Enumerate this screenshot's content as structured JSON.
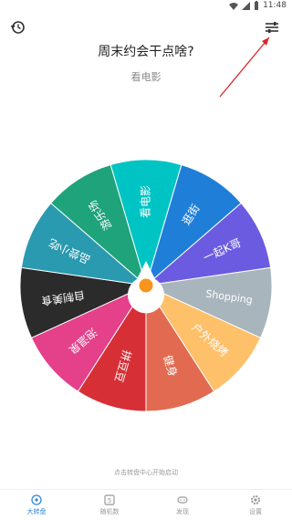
{
  "status_bar": {
    "time": "11:48"
  },
  "header": {
    "question": "周末约会干点啥?",
    "answer": "看电影"
  },
  "wheel": {
    "segments": [
      {
        "label": "看电影",
        "color": "#00c4c4"
      },
      {
        "label": "逛街",
        "color": "#1f7fd8"
      },
      {
        "label": "一起K哥",
        "color": "#6b5be0"
      },
      {
        "label": "Shopping",
        "color": "#a9b5bd"
      },
      {
        "label": "户外烧烤",
        "color": "#ffc06a"
      },
      {
        "label": "健身",
        "color": "#e26a50"
      },
      {
        "label": "拼豆豆",
        "color": "#d72f36"
      },
      {
        "label": "泡温泉",
        "color": "#e5408a"
      },
      {
        "label": "自制美食",
        "color": "#2b2b2b"
      },
      {
        "label": "品尝小吃",
        "color": "#2a9ab0"
      },
      {
        "label": "游乐场",
        "color": "#1ea37a"
      }
    ]
  },
  "hint": "点击转盘中心开始启动",
  "nav": [
    {
      "label": "大转盘",
      "icon": "wheel-icon",
      "active": true
    },
    {
      "label": "随机数",
      "icon": "dice-icon",
      "active": false
    },
    {
      "label": "发现",
      "icon": "gamepad-icon",
      "active": false
    },
    {
      "label": "设置",
      "icon": "gear-icon",
      "active": false
    }
  ],
  "colors": {
    "accent": "#2e86de",
    "arrow": "#d9262c",
    "center": "#f7941d"
  }
}
